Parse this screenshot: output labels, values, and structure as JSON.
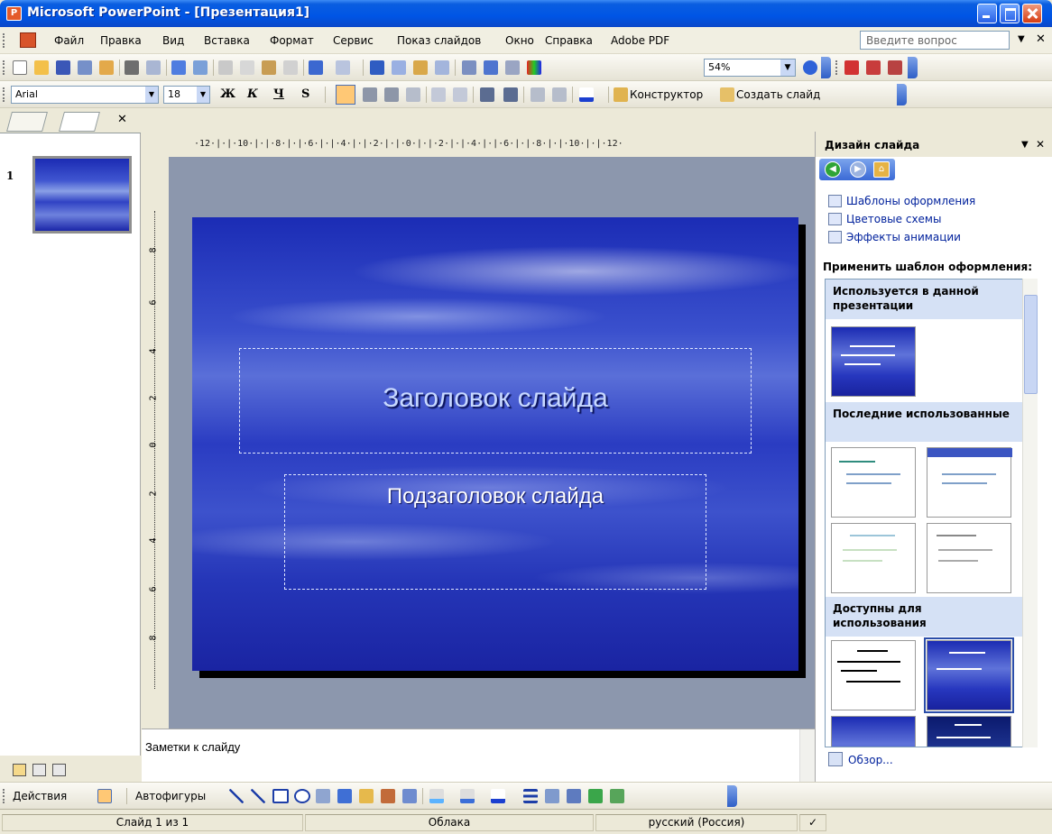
{
  "window": {
    "title": "Microsoft PowerPoint - [Презентация1]"
  },
  "menu": {
    "items": [
      "Файл",
      "Правка",
      "Вид",
      "Вставка",
      "Формат",
      "Сервис",
      "Показ слайдов",
      "Окно",
      "Справка",
      "Adobe PDF"
    ],
    "help_placeholder": "Введите вопрос"
  },
  "standard_toolbar": {
    "zoom": "54%"
  },
  "formatting_toolbar": {
    "font": "Arial",
    "size": "18",
    "bold": "Ж",
    "italic": "К",
    "underline": "Ч",
    "shadow": "S",
    "designer_label": "Конструктор",
    "new_slide_label": "Создать слайд"
  },
  "slides_panel": {
    "slide_number": "1"
  },
  "ruler": {
    "horizontal": "·12·|·|·10·|·|·8·|·|·6·|·|·4·|·|·2·|·|·0·|·|·2·|·|·4·|·|·6·|·|·8·|·|·10·|·|·12·",
    "vertical": [
      "8",
      "6",
      "4",
      "2",
      "0",
      "2",
      "4",
      "6",
      "8"
    ]
  },
  "slide": {
    "title": "Заголовок слайда",
    "subtitle": "Подзаголовок слайда"
  },
  "notes": {
    "placeholder": "Заметки к слайду"
  },
  "task_pane": {
    "title": "Дизайн слайда",
    "links": [
      "Шаблоны оформления",
      "Цветовые схемы",
      "Эффекты анимации"
    ],
    "apply_label": "Применить шаблон оформления:",
    "groups": {
      "current": "Используется в данной презентации",
      "recent": "Последние использованные",
      "available": "Доступны для использования"
    },
    "browse": "Обзор..."
  },
  "drawing_toolbar": {
    "actions": "Действия",
    "autoshapes": "Автофигуры"
  },
  "status": {
    "slide": "Слайд 1 из 1",
    "design": "Облака",
    "language": "русский (Россия)"
  }
}
